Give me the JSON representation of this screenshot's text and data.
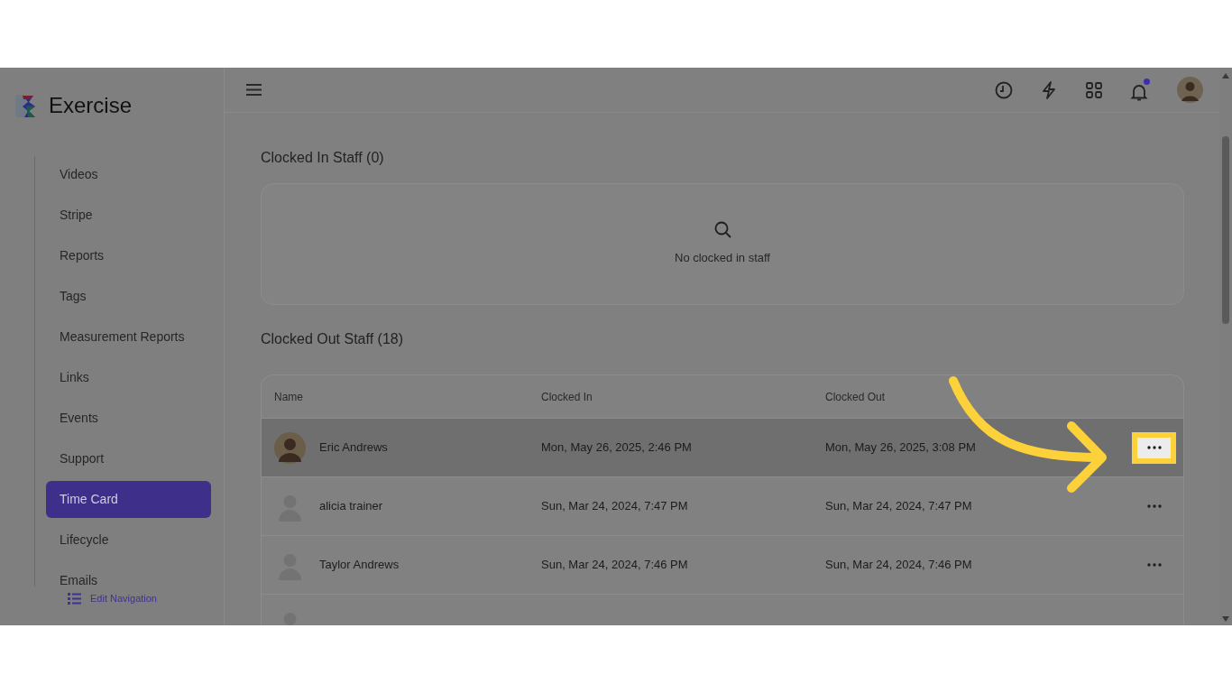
{
  "brand": {
    "name": "Exercise"
  },
  "sidebar": {
    "items": [
      {
        "label": "Videos",
        "selected": false
      },
      {
        "label": "Stripe",
        "selected": false
      },
      {
        "label": "Reports",
        "selected": false
      },
      {
        "label": "Tags",
        "selected": false
      },
      {
        "label": "Measurement Reports",
        "selected": false
      },
      {
        "label": "Links",
        "selected": false
      },
      {
        "label": "Events",
        "selected": false
      },
      {
        "label": "Support",
        "selected": false
      },
      {
        "label": "Time Card",
        "selected": true
      },
      {
        "label": "Lifecycle",
        "selected": false
      },
      {
        "label": "Emails",
        "selected": false
      }
    ],
    "footer_link": "Edit Navigation"
  },
  "header": {
    "notifications_unread": true
  },
  "clocked_in": {
    "title": "Clocked In Staff (0)",
    "empty_text": "No clocked in staff"
  },
  "clocked_out": {
    "title": "Clocked Out Staff (18)",
    "columns": [
      "Name",
      "Clocked In",
      "Clocked Out"
    ],
    "rows": [
      {
        "kind": "photo",
        "name": "Eric Andrews",
        "clocked_in": "Mon, May 26, 2025, 2:46 PM",
        "clocked_out": "Mon, May 26, 2025, 3:08 PM",
        "hovered": true,
        "highlighted": true
      },
      {
        "kind": "placeholder",
        "name": "alicia trainer",
        "clocked_in": "Sun, Mar 24, 2024, 7:47 PM",
        "clocked_out": "Sun, Mar 24, 2024, 7:47 PM",
        "hovered": false,
        "highlighted": false
      },
      {
        "kind": "placeholder",
        "name": "Taylor Andrews",
        "clocked_in": "Sun, Mar 24, 2024, 7:46 PM",
        "clocked_out": "Sun, Mar 24, 2024, 7:46 PM",
        "hovered": false,
        "highlighted": false
      },
      {
        "kind": "placeholder"
      }
    ]
  }
}
